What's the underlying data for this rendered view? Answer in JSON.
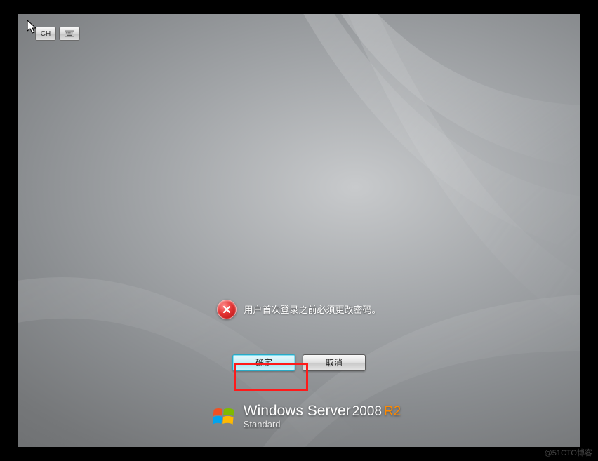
{
  "language_bar": {
    "ime_label": "CH",
    "osk_icon": "keyboard-icon"
  },
  "login_message": {
    "icon": "error-icon",
    "text": "用户首次登录之前必须更改密码。"
  },
  "buttons": {
    "ok_label": "确定",
    "cancel_label": "取消"
  },
  "branding": {
    "line1_windows": "Windows",
    "line1_server": "Server",
    "line1_year": "2008",
    "line1_r2": "R2",
    "edition": "Standard"
  },
  "watermark": "@51CTO博客"
}
